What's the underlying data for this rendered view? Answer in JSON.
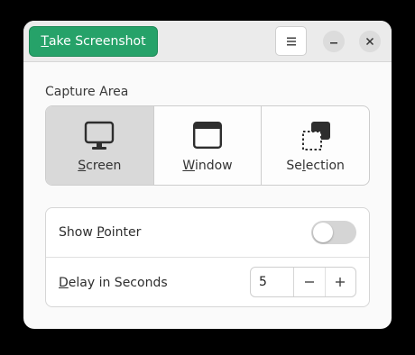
{
  "header": {
    "take_screenshot": {
      "mnemonic": "T",
      "rest": "ake Screenshot"
    }
  },
  "capture_area": {
    "label": "Capture Area",
    "options": [
      {
        "icon": "screen-icon",
        "mnemonic": "S",
        "rest": "creen",
        "active": true
      },
      {
        "icon": "window-icon",
        "mnemonic": "W",
        "rest": "indow",
        "active": false
      },
      {
        "icon": "selection-icon",
        "pre": "Se",
        "mnemonic": "l",
        "rest": "ection",
        "active": false
      }
    ]
  },
  "options": {
    "show_pointer": {
      "pre": "Show ",
      "mnemonic": "P",
      "rest": "ointer",
      "enabled": false
    },
    "delay": {
      "mnemonic": "D",
      "rest": "elay in Seconds",
      "value": "5"
    }
  },
  "colors": {
    "accent": "#26a269",
    "active_bg": "#d9d9d9"
  }
}
